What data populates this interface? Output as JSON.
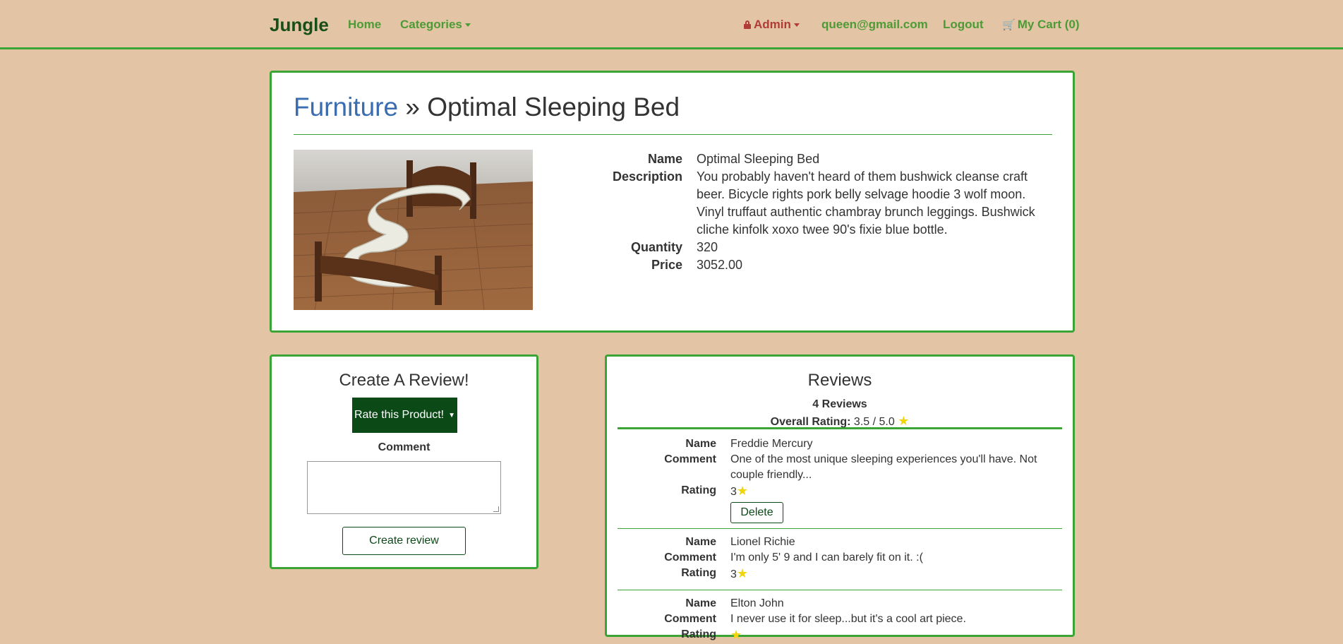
{
  "nav": {
    "brand": "Jungle",
    "home": "Home",
    "categories": "Categories",
    "admin": "Admin",
    "email": "queen@gmail.com",
    "logout": "Logout",
    "cart": "My Cart (0)"
  },
  "product": {
    "category": "Furniture",
    "separator": " » ",
    "title": "Optimal Sleeping Bed",
    "labels": {
      "name": "Name",
      "description": "Description",
      "quantity": "Quantity",
      "price": "Price"
    },
    "name": "Optimal Sleeping Bed",
    "description": "You probably haven't heard of them bushwick cleanse craft beer. Bicycle rights pork belly selvage hoodie 3 wolf moon. Vinyl truffaut authentic chambray brunch leggings. Bushwick cliche kinfolk xoxo twee 90's fixie blue bottle.",
    "quantity": "320",
    "price": "3052.00"
  },
  "create_review": {
    "title": "Create A Review!",
    "rate_button": "Rate this Product!",
    "comment_label": "Comment",
    "submit": "Create review"
  },
  "reviews": {
    "title": "Reviews",
    "count": "4 Reviews",
    "overall_label": "Overall Rating:",
    "overall_value": "3.5 / 5.0",
    "labels": {
      "name": "Name",
      "comment": "Comment",
      "rating": "Rating"
    },
    "delete_label": "Delete",
    "items": [
      {
        "name": "Freddie Mercury",
        "comment": "One of the most unique sleeping experiences you'll have. Not couple friendly...",
        "rating": "3"
      },
      {
        "name": "Lionel Richie",
        "comment": "I'm only 5' 9 and I can barely fit on it. :(",
        "rating": "3"
      },
      {
        "name": "Elton John",
        "comment": "I never use it for sleep...but it's a cool art piece.",
        "rating": ""
      }
    ]
  },
  "colors": {
    "background": "#e3c5a6",
    "accent": "#3aa535",
    "brand": "#174f19",
    "link": "#4d9b34",
    "admin": "#b13b37",
    "breadcrumb": "#3a6cb0",
    "button_dark": "#0b4a17",
    "star": "#f2d40a"
  }
}
